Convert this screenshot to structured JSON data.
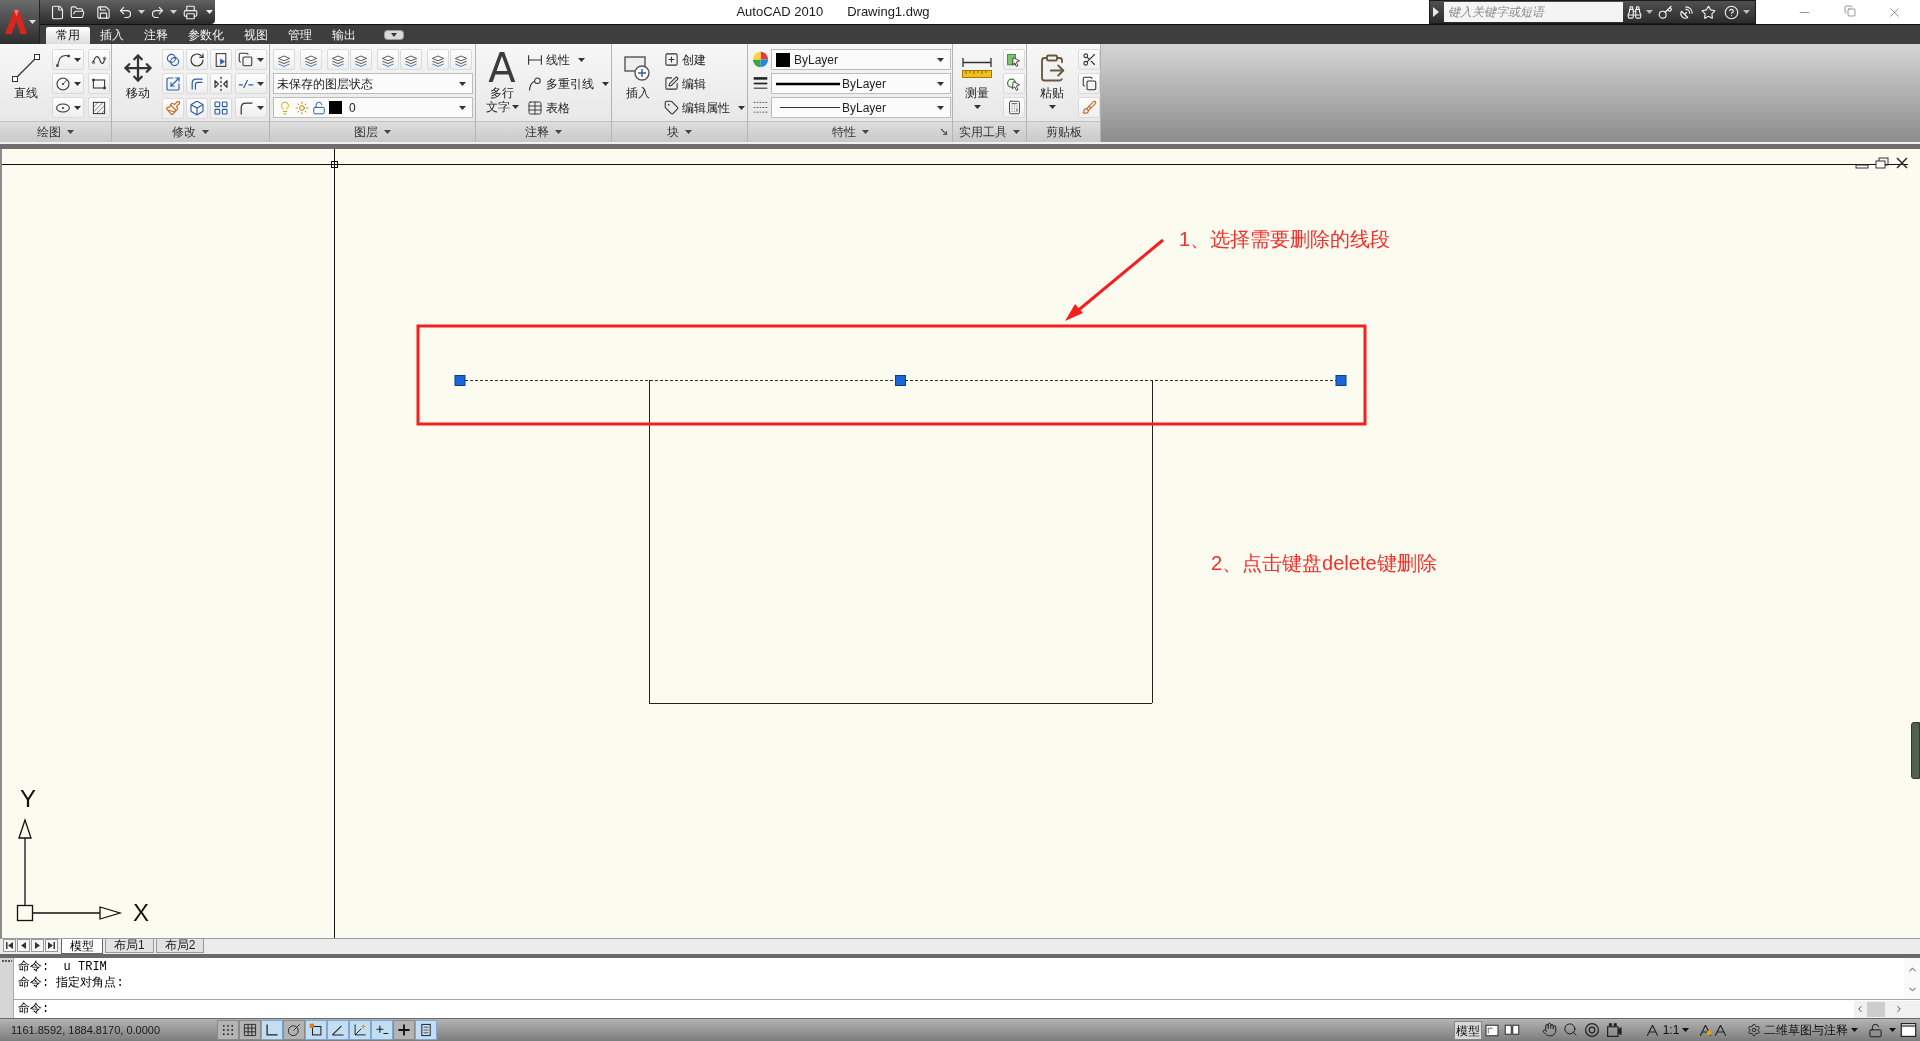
{
  "window": {
    "app_title": "AutoCAD 2010",
    "document_title": "Drawing1.dwg",
    "search": {
      "placeholder": "键入关键字或短语"
    }
  },
  "ribbon": {
    "tabs": [
      {
        "label": "常用",
        "selected": true
      },
      {
        "label": "插入",
        "selected": false
      },
      {
        "label": "注释",
        "selected": false
      },
      {
        "label": "参数化",
        "selected": false
      },
      {
        "label": "视图",
        "selected": false
      },
      {
        "label": "管理",
        "selected": false
      },
      {
        "label": "输出",
        "selected": false
      }
    ],
    "panels": [
      {
        "kind": "draw",
        "title": "绘图",
        "has_menu": true,
        "large_button": {
          "label_lines": [
            "直线"
          ],
          "has_menu": false
        }
      },
      {
        "kind": "modify",
        "title": "修改",
        "has_menu": true,
        "large_button": {
          "label_lines": [
            "移动"
          ],
          "has_menu": false
        }
      },
      {
        "kind": "layers",
        "title": "图层",
        "has_menu": true,
        "layer_state": "未保存的图层状态",
        "current_layer": "0"
      },
      {
        "kind": "annotation",
        "title": "注释",
        "has_menu": true,
        "large_button": {
          "icon_glyph": "A",
          "label_lines": [
            "多行",
            "文字"
          ],
          "has_menu": true
        },
        "small_buttons": [
          {
            "label": "线性",
            "has_menu": true
          },
          {
            "label": "多重引线",
            "has_menu": true
          },
          {
            "label": "表格",
            "has_menu": false
          }
        ]
      },
      {
        "kind": "block",
        "title": "块",
        "has_menu": true,
        "large_button": {
          "label_lines": [
            "插入"
          ],
          "has_menu": false
        },
        "small_buttons": [
          {
            "label": "创建",
            "has_menu": false
          },
          {
            "label": "编辑",
            "has_menu": false
          },
          {
            "label": "编辑属性",
            "has_menu": true
          }
        ]
      },
      {
        "kind": "properties",
        "title": "特性",
        "has_menu": true,
        "object_color_setting": "ByLayer",
        "lineweight": "ByLayer",
        "linetype": "ByLayer"
      },
      {
        "kind": "utilities",
        "title": "实用工具",
        "has_menu": true,
        "large_button": {
          "label_lines": [
            "测量"
          ],
          "has_menu": true
        }
      },
      {
        "kind": "clipboard",
        "title": "剪贴板",
        "has_menu": false,
        "large_button": {
          "label_lines": [
            "粘贴"
          ],
          "has_menu": true
        }
      }
    ]
  },
  "drawing": {
    "segments": [
      {
        "kind": "top",
        "selected": true
      },
      {
        "kind": "left",
        "selected": false
      },
      {
        "kind": "right",
        "selected": false
      },
      {
        "kind": "bottom",
        "selected": false
      }
    ],
    "annotations": [
      "1、选择需要删除的线段",
      "2、点击键盘delete键删除"
    ],
    "ucs": {
      "x_label": "X",
      "y_label": "Y"
    }
  },
  "layout_tabs": [
    {
      "label": "模型",
      "selected": true
    },
    {
      "label": "布局1",
      "selected": false
    },
    {
      "label": "布局2",
      "selected": false
    }
  ],
  "command_line": {
    "history": [
      "命令:  u TRIM",
      "命令: 指定对角点:"
    ],
    "prompt": "命令:"
  },
  "status_bar": {
    "coordinates": "1161.8592, 1884.8170, 0.0000",
    "toggles": [
      {
        "kind": "snap",
        "on": false
      },
      {
        "kind": "grid",
        "on": false
      },
      {
        "kind": "ortho",
        "on": true
      },
      {
        "kind": "polar",
        "on": false
      },
      {
        "kind": "osnap",
        "on": true
      },
      {
        "kind": "otrack",
        "on": true
      },
      {
        "kind": "ducs",
        "on": true
      },
      {
        "kind": "dyn",
        "on": true
      },
      {
        "kind": "lwt",
        "on": false
      },
      {
        "kind": "qp",
        "on": true
      }
    ],
    "model_button": "模型",
    "annotation_scale": "1:1",
    "workspace": "二维草图与注释"
  }
}
